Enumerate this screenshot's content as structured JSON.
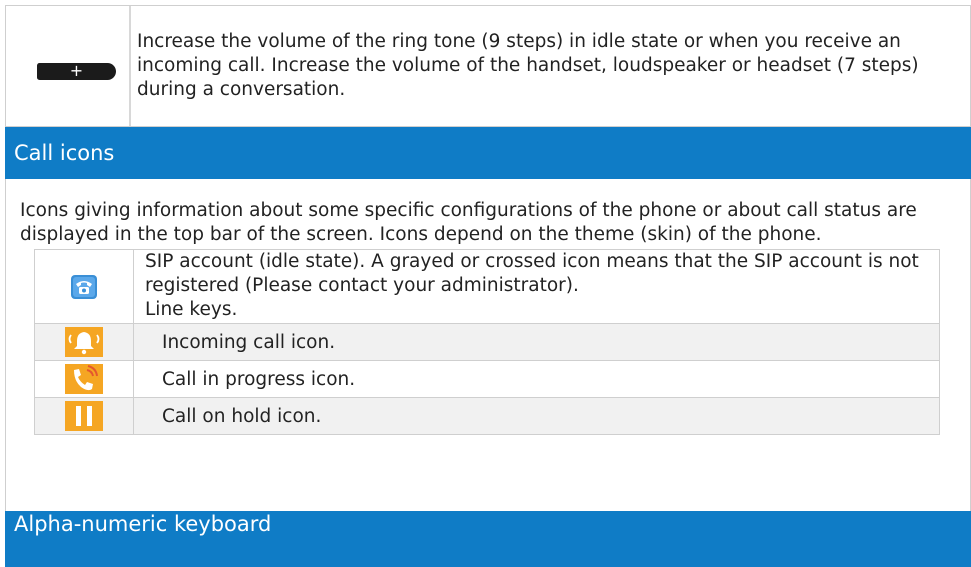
{
  "top_row": {
    "key_icon": "volume-up-key-icon",
    "key_symbol": "+",
    "text": "Increase the volume of the ring tone (9 steps) in idle state or when you receive an incoming call. Increase the volume of the handset, loudspeaker or headset (7 steps) during a conversation."
  },
  "call_icons_section": {
    "title": "Call icons",
    "intro": "Icons giving information about some specific configurations of the phone or about call status are displayed in the top bar of the screen. Icons depend on the theme (skin) of the phone.",
    "rows": [
      {
        "icon": "sip-account-phone-icon",
        "text": "SIP account (idle state). A grayed or crossed icon means that the SIP account is not registered (Please contact your administrator).",
        "text2": "Line keys."
      },
      {
        "icon": "incoming-call-bell-icon",
        "text": "Incoming call icon."
      },
      {
        "icon": "call-in-progress-icon",
        "text": "Call in progress icon."
      },
      {
        "icon": "call-on-hold-pause-icon",
        "text": "Call on hold icon."
      }
    ]
  },
  "keyboard_section": {
    "title": "Alpha-numeric keyboard"
  },
  "colors": {
    "header_blue": "#0f7cc6",
    "icon_blue": "#3a8fd6",
    "icon_orange": "#f5a623",
    "key_black": "#1b1b1b",
    "alt_row": "#f1f1f1"
  }
}
